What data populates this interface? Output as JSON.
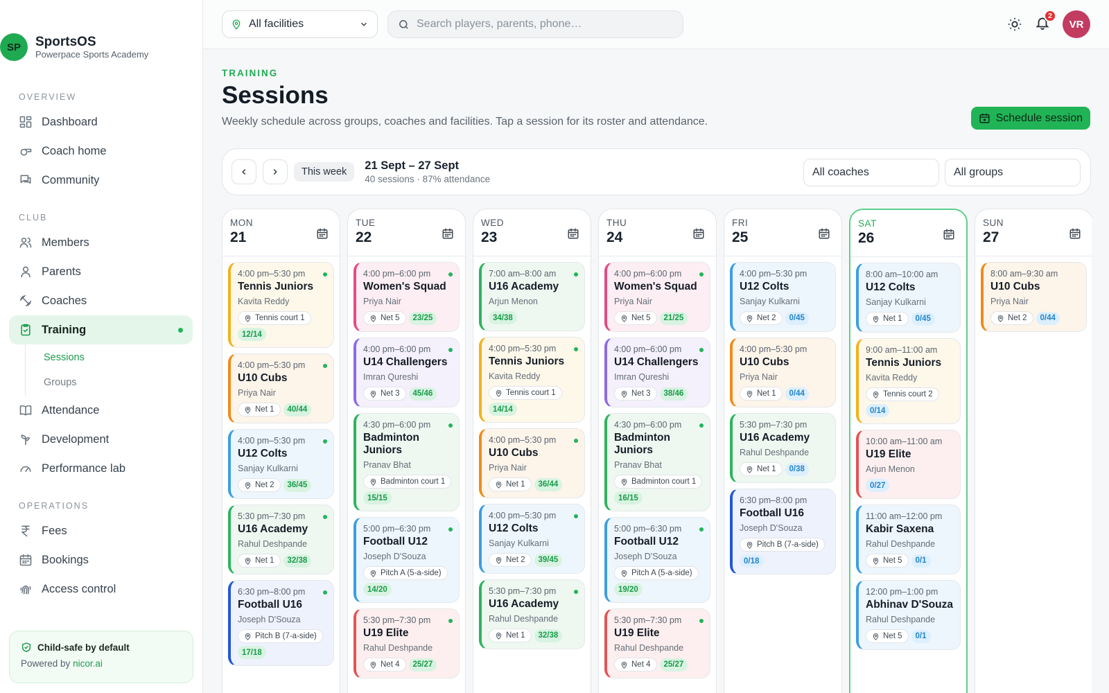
{
  "brand": {
    "logo": "SP",
    "name": "SportsOS",
    "subtitle": "Powerpace Sports Academy"
  },
  "nav": {
    "sections": [
      {
        "label": "OVERVIEW",
        "items": [
          {
            "label": "Dashboard",
            "icon": "grid-icon"
          },
          {
            "label": "Coach home",
            "icon": "whistle-icon"
          },
          {
            "label": "Community",
            "icon": "chat-icon"
          }
        ]
      },
      {
        "label": "CLUB",
        "items": [
          {
            "label": "Members",
            "icon": "users-icon"
          },
          {
            "label": "Parents",
            "icon": "user-icon"
          },
          {
            "label": "Coaches",
            "icon": "dumbbell-icon"
          },
          {
            "label": "Training",
            "icon": "clipboard-icon",
            "active": true,
            "sub": [
              {
                "label": "Sessions",
                "active": true
              },
              {
                "label": "Groups"
              }
            ]
          },
          {
            "label": "Attendance",
            "icon": "book-icon"
          },
          {
            "label": "Development",
            "icon": "sprout-icon"
          },
          {
            "label": "Performance lab",
            "icon": "gauge-icon"
          }
        ]
      },
      {
        "label": "OPERATIONS",
        "items": [
          {
            "label": "Fees",
            "icon": "rupee-icon"
          },
          {
            "label": "Bookings",
            "icon": "calendar-icon"
          },
          {
            "label": "Access control",
            "icon": "fingerprint-icon"
          }
        ]
      }
    ]
  },
  "safe": {
    "title": "Child-safe by default",
    "powered_prefix": "Powered by",
    "powered_link": "nicor.ai"
  },
  "topbar": {
    "facility": "All facilities",
    "search_placeholder": "Search players, parents, phone…",
    "notifications": "2",
    "avatar": "VR"
  },
  "page": {
    "crumb": "TRAINING",
    "title": "Sessions",
    "description": "Weekly schedule across groups, coaches and facilities. Tap a session for its roster and attendance.",
    "schedule_button": "Schedule session"
  },
  "week": {
    "this_week": "This week",
    "range": "21 Sept – 27 Sept",
    "summary": "40 sessions · 87% attendance",
    "coach_filter": "All coaches",
    "group_filter": "All groups"
  },
  "colors": {
    "accent": "#21b457",
    "badge": "#e33131",
    "avatar": "#c23c62"
  },
  "days": [
    {
      "dow": "MON",
      "num": "21",
      "sessions": [
        {
          "time": "4:00 pm–5:30 pm",
          "title": "Tennis Juniors",
          "coach": "Kavita Reddy",
          "place": "Tennis court 1",
          "count": "12/14",
          "color": "amber",
          "countColor": "green"
        },
        {
          "time": "4:00 pm–5:30 pm",
          "title": "U10 Cubs",
          "coach": "Priya Nair",
          "place": "Net 1",
          "count": "40/44",
          "color": "orange",
          "countColor": "green"
        },
        {
          "time": "4:00 pm–5:30 pm",
          "title": "U12 Colts",
          "coach": "Sanjay Kulkarni",
          "place": "Net 2",
          "count": "36/45",
          "color": "blue",
          "countColor": "green"
        },
        {
          "time": "5:30 pm–7:30 pm",
          "title": "U16 Academy",
          "coach": "Rahul Deshpande",
          "place": "Net 1",
          "count": "32/38",
          "color": "green",
          "countColor": "green"
        },
        {
          "time": "6:30 pm–8:00 pm",
          "title": "Football U16",
          "coach": "Joseph D'Souza",
          "place": "Pitch B (7-a-side)",
          "count": "17/18",
          "color": "navy",
          "countColor": "green"
        }
      ]
    },
    {
      "dow": "TUE",
      "num": "22",
      "sessions": [
        {
          "time": "4:00 pm–6:00 pm",
          "title": "Women's Squad",
          "coach": "Priya Nair",
          "place": "Net 5",
          "count": "23/25",
          "color": "pink",
          "countColor": "green"
        },
        {
          "time": "4:00 pm–6:00 pm",
          "title": "U14 Challengers",
          "coach": "Imran Qureshi",
          "place": "Net 3",
          "count": "45/46",
          "color": "purple",
          "countColor": "green"
        },
        {
          "time": "4:30 pm–6:00 pm",
          "title": "Badminton Juniors",
          "coach": "Pranav Bhat",
          "place": "Badminton court 1",
          "count": "15/15",
          "color": "green",
          "countColor": "green"
        },
        {
          "time": "5:00 pm–6:30 pm",
          "title": "Football U12",
          "coach": "Joseph D'Souza",
          "place": "Pitch A (5-a-side)",
          "count": "14/20",
          "color": "blue",
          "countColor": "green"
        },
        {
          "time": "5:30 pm–7:30 pm",
          "title": "U19 Elite",
          "coach": "Rahul Deshpande",
          "place": "Net 4",
          "count": "25/27",
          "color": "red",
          "countColor": "green"
        }
      ]
    },
    {
      "dow": "WED",
      "num": "23",
      "sessions": [
        {
          "time": "7:00 am–8:00 am",
          "title": "U16 Academy",
          "coach": "Arjun Menon",
          "place": "",
          "count": "34/38",
          "color": "green",
          "countColor": "green"
        },
        {
          "time": "4:00 pm–5:30 pm",
          "title": "Tennis Juniors",
          "coach": "Kavita Reddy",
          "place": "Tennis court 1",
          "count": "14/14",
          "color": "amber",
          "countColor": "green"
        },
        {
          "time": "4:00 pm–5:30 pm",
          "title": "U10 Cubs",
          "coach": "Priya Nair",
          "place": "Net 1",
          "count": "36/44",
          "color": "orange",
          "countColor": "green"
        },
        {
          "time": "4:00 pm–5:30 pm",
          "title": "U12 Colts",
          "coach": "Sanjay Kulkarni",
          "place": "Net 2",
          "count": "39/45",
          "color": "blue",
          "countColor": "green"
        },
        {
          "time": "5:30 pm–7:30 pm",
          "title": "U16 Academy",
          "coach": "Rahul Deshpande",
          "place": "Net 1",
          "count": "32/38",
          "color": "green",
          "countColor": "green"
        }
      ]
    },
    {
      "dow": "THU",
      "num": "24",
      "sessions": [
        {
          "time": "4:00 pm–6:00 pm",
          "title": "Women's Squad",
          "coach": "Priya Nair",
          "place": "Net 5",
          "count": "21/25",
          "color": "pink",
          "countColor": "green"
        },
        {
          "time": "4:00 pm–6:00 pm",
          "title": "U14 Challengers",
          "coach": "Imran Qureshi",
          "place": "Net 3",
          "count": "38/46",
          "color": "purple",
          "countColor": "green"
        },
        {
          "time": "4:30 pm–6:00 pm",
          "title": "Badminton Juniors",
          "coach": "Pranav Bhat",
          "place": "Badminton court 1",
          "count": "16/15",
          "color": "green",
          "countColor": "green"
        },
        {
          "time": "5:00 pm–6:30 pm",
          "title": "Football U12",
          "coach": "Joseph D'Souza",
          "place": "Pitch A (5-a-side)",
          "count": "19/20",
          "color": "blue",
          "countColor": "green"
        },
        {
          "time": "5:30 pm–7:30 pm",
          "title": "U19 Elite",
          "coach": "Rahul Deshpande",
          "place": "Net 4",
          "count": "25/27",
          "color": "red",
          "countColor": "green"
        }
      ]
    },
    {
      "dow": "FRI",
      "num": "25",
      "sessions": [
        {
          "time": "4:00 pm–5:30 pm",
          "title": "U12 Colts",
          "coach": "Sanjay Kulkarni",
          "place": "Net 2",
          "count": "0/45",
          "color": "blue",
          "countColor": "blue"
        },
        {
          "time": "4:00 pm–5:30 pm",
          "title": "U10 Cubs",
          "coach": "Priya Nair",
          "place": "Net 1",
          "count": "0/44",
          "color": "orange",
          "countColor": "blue"
        },
        {
          "time": "5:30 pm–7:30 pm",
          "title": "U16 Academy",
          "coach": "Rahul Deshpande",
          "place": "Net 1",
          "count": "0/38",
          "color": "green",
          "countColor": "blue"
        },
        {
          "time": "6:30 pm–8:00 pm",
          "title": "Football U16",
          "coach": "Joseph D'Souza",
          "place": "Pitch B (7-a-side)",
          "count": "0/18",
          "color": "navy",
          "countColor": "blue"
        }
      ]
    },
    {
      "dow": "SAT",
      "num": "26",
      "today": true,
      "sessions": [
        {
          "time": "8:00 am–10:00 am",
          "title": "U12 Colts",
          "coach": "Sanjay Kulkarni",
          "place": "Net 1",
          "count": "0/45",
          "color": "blue",
          "countColor": "blue"
        },
        {
          "time": "9:00 am–11:00 am",
          "title": "Tennis Juniors",
          "coach": "Kavita Reddy",
          "place": "Tennis court 2",
          "count": "0/14",
          "color": "amber",
          "countColor": "blue"
        },
        {
          "time": "10:00 am–11:00 am",
          "title": "U19 Elite",
          "coach": "Arjun Menon",
          "place": "",
          "count": "0/27",
          "color": "red",
          "countColor": "blue"
        },
        {
          "time": "11:00 am–12:00 pm",
          "title": "Kabir Saxena",
          "coach": "Rahul Deshpande",
          "place": "Net 5",
          "count": "0/1",
          "color": "blue",
          "countColor": "blue"
        },
        {
          "time": "12:00 pm–1:00 pm",
          "title": "Abhinav D'Souza",
          "coach": "Rahul Deshpande",
          "place": "Net 5",
          "count": "0/1",
          "color": "blue",
          "countColor": "blue"
        }
      ]
    },
    {
      "dow": "SUN",
      "num": "27",
      "sessions": [
        {
          "time": "8:00 am–9:30 am",
          "title": "U10 Cubs",
          "coach": "Priya Nair",
          "place": "Net 2",
          "count": "0/44",
          "color": "orange",
          "countColor": "blue"
        }
      ]
    }
  ]
}
